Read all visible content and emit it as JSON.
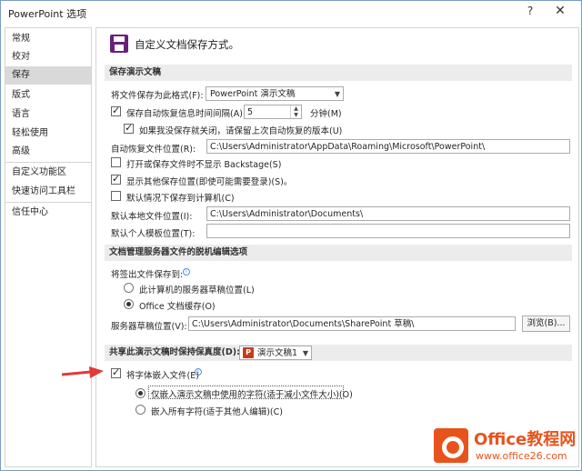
{
  "window": {
    "title": "PowerPoint 选项",
    "help_label": "?",
    "close_label": "✕"
  },
  "nav": {
    "items": [
      {
        "label": "常规"
      },
      {
        "label": "校对"
      },
      {
        "label": "保存"
      },
      {
        "label": "版式"
      },
      {
        "label": "语言"
      },
      {
        "label": "轻松使用"
      },
      {
        "label": "高级"
      },
      {
        "label": "自定义功能区"
      },
      {
        "label": "快速访问工具栏"
      },
      {
        "label": "信任中心"
      }
    ],
    "selected": "保存"
  },
  "page": {
    "heading": "自定义文档保存方式。"
  },
  "save_presentations": {
    "header": "保存演示文稿",
    "format_label": "将文件保存为此格式(F):",
    "format_value": "PowerPoint 演示文稿",
    "autorecover_label": "保存自动恢复信息时间间隔(A)",
    "autorecover_checked": true,
    "autorecover_minutes": "5",
    "minutes_label": "分钟(M)",
    "keep_last_label": "如果我没保存就关闭，请保留上次自动恢复的版本(U)",
    "keep_last_checked": true,
    "autorecover_location_label": "自动恢复文件位置(R):",
    "autorecover_location_value": "C:\\Users\\Administrator\\AppData\\Roaming\\Microsoft\\PowerPoint\\",
    "no_backstage_label": "打开或保存文件时不显示 Backstage(S)",
    "no_backstage_checked": false,
    "show_other_label": "显示其他保存位置(即使可能需要登录)(S)。",
    "show_other_checked": true,
    "save_to_computer_label": "默认情况下保存到计算机(C)",
    "save_to_computer_checked": false,
    "default_local_label": "默认本地文件位置(I):",
    "default_local_value": "C:\\Users\\Administrator\\Documents\\",
    "default_template_label": "默认个人模板位置(T):",
    "default_template_value": ""
  },
  "offline_editing": {
    "header": "文档管理服务器文件的脱机编辑选项",
    "checkout_label": "将签出文件保存到:",
    "option_server_label": "此计算机的服务器草稿位置(L)",
    "option_server_checked": false,
    "option_cache_label": "Office 文档缓存(O)",
    "option_cache_checked": true,
    "drafts_label": "服务器草稿位置(V):",
    "drafts_value": "C:\\Users\\Administrator\\Documents\\SharePoint 草稿\\",
    "browse_label": "浏览(B)..."
  },
  "fidelity": {
    "header": "共享此演示文稿时保持保真度(D):",
    "presentation_value": "演示文稿1",
    "embed_fonts_label": "将字体嵌入文件(E)",
    "embed_fonts_checked": true,
    "embed_used_label": "仅嵌入演示文稿中使用的字符(适于减小文件大小)(O)",
    "embed_used_checked": true,
    "embed_all_label": "嵌入所有字符(适于其他人编辑)(C)",
    "embed_all_checked": false
  },
  "watermark": {
    "brand": "Office教程网",
    "url": "www.office26.com"
  },
  "colors": {
    "accent_purple": "#68217a",
    "ppt_red": "#c43e1c",
    "annotation_red": "#e03a3a",
    "watermark_orange": "#e8531c",
    "selected_nav": "#d9d9d9"
  }
}
